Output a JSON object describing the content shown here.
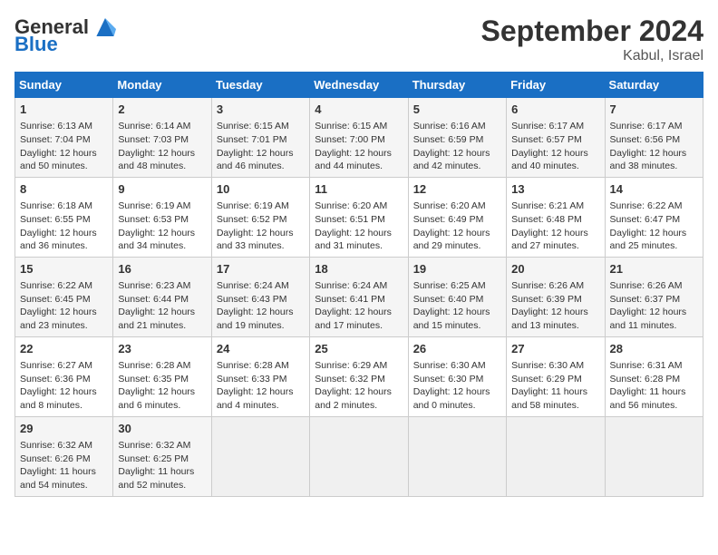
{
  "header": {
    "logo_general": "General",
    "logo_blue": "Blue",
    "month_title": "September 2024",
    "location": "Kabul, Israel"
  },
  "days_of_week": [
    "Sunday",
    "Monday",
    "Tuesday",
    "Wednesday",
    "Thursday",
    "Friday",
    "Saturday"
  ],
  "weeks": [
    [
      {
        "day": 1,
        "lines": [
          "Sunrise: 6:13 AM",
          "Sunset: 7:04 PM",
          "Daylight: 12 hours",
          "and 50 minutes."
        ]
      },
      {
        "day": 2,
        "lines": [
          "Sunrise: 6:14 AM",
          "Sunset: 7:03 PM",
          "Daylight: 12 hours",
          "and 48 minutes."
        ]
      },
      {
        "day": 3,
        "lines": [
          "Sunrise: 6:15 AM",
          "Sunset: 7:01 PM",
          "Daylight: 12 hours",
          "and 46 minutes."
        ]
      },
      {
        "day": 4,
        "lines": [
          "Sunrise: 6:15 AM",
          "Sunset: 7:00 PM",
          "Daylight: 12 hours",
          "and 44 minutes."
        ]
      },
      {
        "day": 5,
        "lines": [
          "Sunrise: 6:16 AM",
          "Sunset: 6:59 PM",
          "Daylight: 12 hours",
          "and 42 minutes."
        ]
      },
      {
        "day": 6,
        "lines": [
          "Sunrise: 6:17 AM",
          "Sunset: 6:57 PM",
          "Daylight: 12 hours",
          "and 40 minutes."
        ]
      },
      {
        "day": 7,
        "lines": [
          "Sunrise: 6:17 AM",
          "Sunset: 6:56 PM",
          "Daylight: 12 hours",
          "and 38 minutes."
        ]
      }
    ],
    [
      {
        "day": 8,
        "lines": [
          "Sunrise: 6:18 AM",
          "Sunset: 6:55 PM",
          "Daylight: 12 hours",
          "and 36 minutes."
        ]
      },
      {
        "day": 9,
        "lines": [
          "Sunrise: 6:19 AM",
          "Sunset: 6:53 PM",
          "Daylight: 12 hours",
          "and 34 minutes."
        ]
      },
      {
        "day": 10,
        "lines": [
          "Sunrise: 6:19 AM",
          "Sunset: 6:52 PM",
          "Daylight: 12 hours",
          "and 33 minutes."
        ]
      },
      {
        "day": 11,
        "lines": [
          "Sunrise: 6:20 AM",
          "Sunset: 6:51 PM",
          "Daylight: 12 hours",
          "and 31 minutes."
        ]
      },
      {
        "day": 12,
        "lines": [
          "Sunrise: 6:20 AM",
          "Sunset: 6:49 PM",
          "Daylight: 12 hours",
          "and 29 minutes."
        ]
      },
      {
        "day": 13,
        "lines": [
          "Sunrise: 6:21 AM",
          "Sunset: 6:48 PM",
          "Daylight: 12 hours",
          "and 27 minutes."
        ]
      },
      {
        "day": 14,
        "lines": [
          "Sunrise: 6:22 AM",
          "Sunset: 6:47 PM",
          "Daylight: 12 hours",
          "and 25 minutes."
        ]
      }
    ],
    [
      {
        "day": 15,
        "lines": [
          "Sunrise: 6:22 AM",
          "Sunset: 6:45 PM",
          "Daylight: 12 hours",
          "and 23 minutes."
        ]
      },
      {
        "day": 16,
        "lines": [
          "Sunrise: 6:23 AM",
          "Sunset: 6:44 PM",
          "Daylight: 12 hours",
          "and 21 minutes."
        ]
      },
      {
        "day": 17,
        "lines": [
          "Sunrise: 6:24 AM",
          "Sunset: 6:43 PM",
          "Daylight: 12 hours",
          "and 19 minutes."
        ]
      },
      {
        "day": 18,
        "lines": [
          "Sunrise: 6:24 AM",
          "Sunset: 6:41 PM",
          "Daylight: 12 hours",
          "and 17 minutes."
        ]
      },
      {
        "day": 19,
        "lines": [
          "Sunrise: 6:25 AM",
          "Sunset: 6:40 PM",
          "Daylight: 12 hours",
          "and 15 minutes."
        ]
      },
      {
        "day": 20,
        "lines": [
          "Sunrise: 6:26 AM",
          "Sunset: 6:39 PM",
          "Daylight: 12 hours",
          "and 13 minutes."
        ]
      },
      {
        "day": 21,
        "lines": [
          "Sunrise: 6:26 AM",
          "Sunset: 6:37 PM",
          "Daylight: 12 hours",
          "and 11 minutes."
        ]
      }
    ],
    [
      {
        "day": 22,
        "lines": [
          "Sunrise: 6:27 AM",
          "Sunset: 6:36 PM",
          "Daylight: 12 hours",
          "and 8 minutes."
        ]
      },
      {
        "day": 23,
        "lines": [
          "Sunrise: 6:28 AM",
          "Sunset: 6:35 PM",
          "Daylight: 12 hours",
          "and 6 minutes."
        ]
      },
      {
        "day": 24,
        "lines": [
          "Sunrise: 6:28 AM",
          "Sunset: 6:33 PM",
          "Daylight: 12 hours",
          "and 4 minutes."
        ]
      },
      {
        "day": 25,
        "lines": [
          "Sunrise: 6:29 AM",
          "Sunset: 6:32 PM",
          "Daylight: 12 hours",
          "and 2 minutes."
        ]
      },
      {
        "day": 26,
        "lines": [
          "Sunrise: 6:30 AM",
          "Sunset: 6:30 PM",
          "Daylight: 12 hours",
          "and 0 minutes."
        ]
      },
      {
        "day": 27,
        "lines": [
          "Sunrise: 6:30 AM",
          "Sunset: 6:29 PM",
          "Daylight: 11 hours",
          "and 58 minutes."
        ]
      },
      {
        "day": 28,
        "lines": [
          "Sunrise: 6:31 AM",
          "Sunset: 6:28 PM",
          "Daylight: 11 hours",
          "and 56 minutes."
        ]
      }
    ],
    [
      {
        "day": 29,
        "lines": [
          "Sunrise: 6:32 AM",
          "Sunset: 6:26 PM",
          "Daylight: 11 hours",
          "and 54 minutes."
        ]
      },
      {
        "day": 30,
        "lines": [
          "Sunrise: 6:32 AM",
          "Sunset: 6:25 PM",
          "Daylight: 11 hours",
          "and 52 minutes."
        ]
      },
      null,
      null,
      null,
      null,
      null
    ]
  ]
}
